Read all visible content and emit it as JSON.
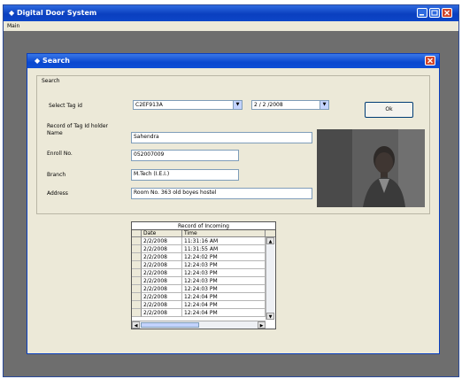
{
  "window": {
    "title": "Digital Door System"
  },
  "menu": {
    "items": [
      "Main"
    ]
  },
  "dialog": {
    "title": "Search",
    "group_label": "Search",
    "select_tag_label": "Select Tag id",
    "tag_id_value": "C2EF913A",
    "date_value": "2 / 2 /2008",
    "ok_label": "Ok",
    "record_label": "Record of Tag Id holder",
    "name_label": "Name",
    "name_value": "Sahendra",
    "enroll_label": "Enroll No.",
    "enroll_value": "052007009",
    "branch_label": "Branch",
    "branch_value": "M.Tech (I.E.I.)",
    "address_label": "Address",
    "address_value": "Room No. 363 old boyes hostel"
  },
  "grid": {
    "caption": "Record of Incoming",
    "columns": [
      "Date",
      "Time"
    ],
    "rows": [
      [
        "2/2/2008",
        "11:31:16 AM"
      ],
      [
        "2/2/2008",
        "11:31:55 AM"
      ],
      [
        "2/2/2008",
        "12:24:02 PM"
      ],
      [
        "2/2/2008",
        "12:24:03 PM"
      ],
      [
        "2/2/2008",
        "12:24:03 PM"
      ],
      [
        "2/2/2008",
        "12:24:03 PM"
      ],
      [
        "2/2/2008",
        "12:24:03 PM"
      ],
      [
        "2/2/2008",
        "12:24:04 PM"
      ],
      [
        "2/2/2008",
        "12:24:04 PM"
      ],
      [
        "2/2/2008",
        "12:24:04 PM"
      ]
    ]
  },
  "icons": {
    "app": "app-icon",
    "minimize": "minimize-icon",
    "maximize": "maximize-icon",
    "close": "close-icon",
    "dropdown": "chevron-down-icon"
  },
  "colors": {
    "titlebar": "#0a3fbf",
    "close": "#d2452a",
    "dialog_bg": "#ece9d8",
    "desktop": "#6e6e6e"
  }
}
